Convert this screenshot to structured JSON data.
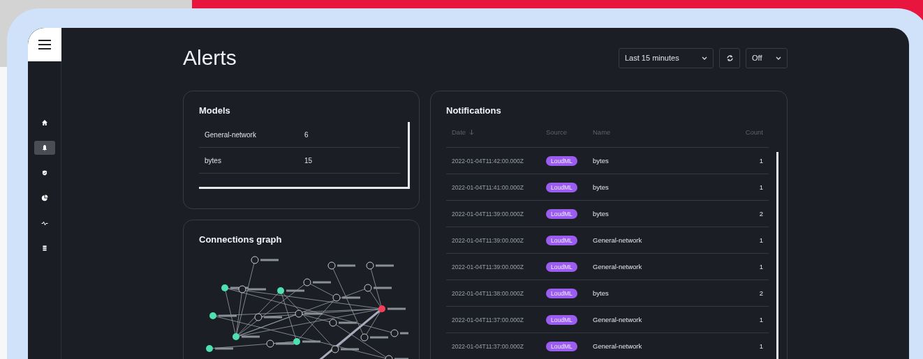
{
  "nav": {
    "items": [
      {
        "selected": false
      },
      {
        "selected": true
      },
      {
        "selected": false
      },
      {
        "selected": false
      },
      {
        "selected": false
      },
      {
        "selected": false
      }
    ]
  },
  "page_title": "Alerts",
  "toolbar": {
    "time_range": "Last 15 minutes",
    "auto_refresh": "Off"
  },
  "models": {
    "title": "Models",
    "rows": [
      {
        "name": "General-network",
        "count": "6"
      },
      {
        "name": "bytes",
        "count": "15"
      }
    ]
  },
  "connections_graph": {
    "title": "Connections graph"
  },
  "notifications": {
    "title": "Notifications",
    "columns": [
      "Date",
      "Source",
      "Name",
      "Count"
    ],
    "rows": [
      {
        "date": "2022-01-04T11:42:00.000Z",
        "source": "LoudML",
        "name": "bytes",
        "count": "1"
      },
      {
        "date": "2022-01-04T11:41:00.000Z",
        "source": "LoudML",
        "name": "bytes",
        "count": "1"
      },
      {
        "date": "2022-01-04T11:39:00.000Z",
        "source": "LoudML",
        "name": "bytes",
        "count": "2"
      },
      {
        "date": "2022-01-04T11:39:00.000Z",
        "source": "LoudML",
        "name": "General-network",
        "count": "1"
      },
      {
        "date": "2022-01-04T11:39:00.000Z",
        "source": "LoudML",
        "name": "General-network",
        "count": "1"
      },
      {
        "date": "2022-01-04T11:38:00.000Z",
        "source": "LoudML",
        "name": "bytes",
        "count": "2"
      },
      {
        "date": "2022-01-04T11:37:00.000Z",
        "source": "LoudML",
        "name": "General-network",
        "count": "1"
      },
      {
        "date": "2022-01-04T11:37:00.000Z",
        "source": "LoudML",
        "name": "General-network",
        "count": "1"
      }
    ]
  }
}
